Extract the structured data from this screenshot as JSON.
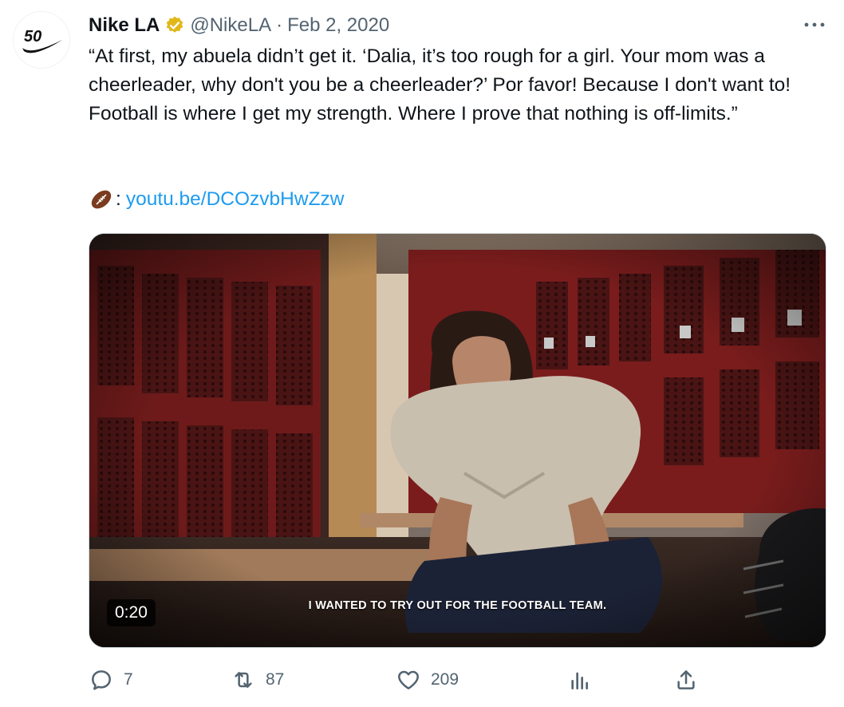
{
  "author": {
    "avatar_text": "50",
    "name": "Nike LA",
    "handle": "@NikeLA",
    "separator": "·",
    "date": "Feb 2, 2020"
  },
  "tweet": {
    "text": "“At first, my abuela didn’t get it. ‘Dalia, it’s too rough for a girl. Your mom was a cheerleader, why don't you be a cheerleader?’ Por favor! Because I don't want to! Football is where I get my strength. Where I prove that nothing is off-limits.”",
    "emoji_label": "🏈",
    "link_prefix": ":",
    "link": "youtu.be/DCOzvbHwZzw"
  },
  "media": {
    "duration": "0:20",
    "caption": "I WANTED TO TRY OUT FOR THE FOOTBALL TEAM."
  },
  "actions": {
    "replies": "7",
    "retweets": "87",
    "likes": "209"
  },
  "icons": {
    "verified": "verified-badge-icon",
    "more": "more-icon",
    "reply": "reply-icon",
    "retweet": "retweet-icon",
    "like": "heart-icon",
    "views": "views-icon",
    "share": "share-icon"
  },
  "colors": {
    "link": "#1d9bf0",
    "secondary_text": "#536471",
    "verified_gold": "#e2b719"
  }
}
